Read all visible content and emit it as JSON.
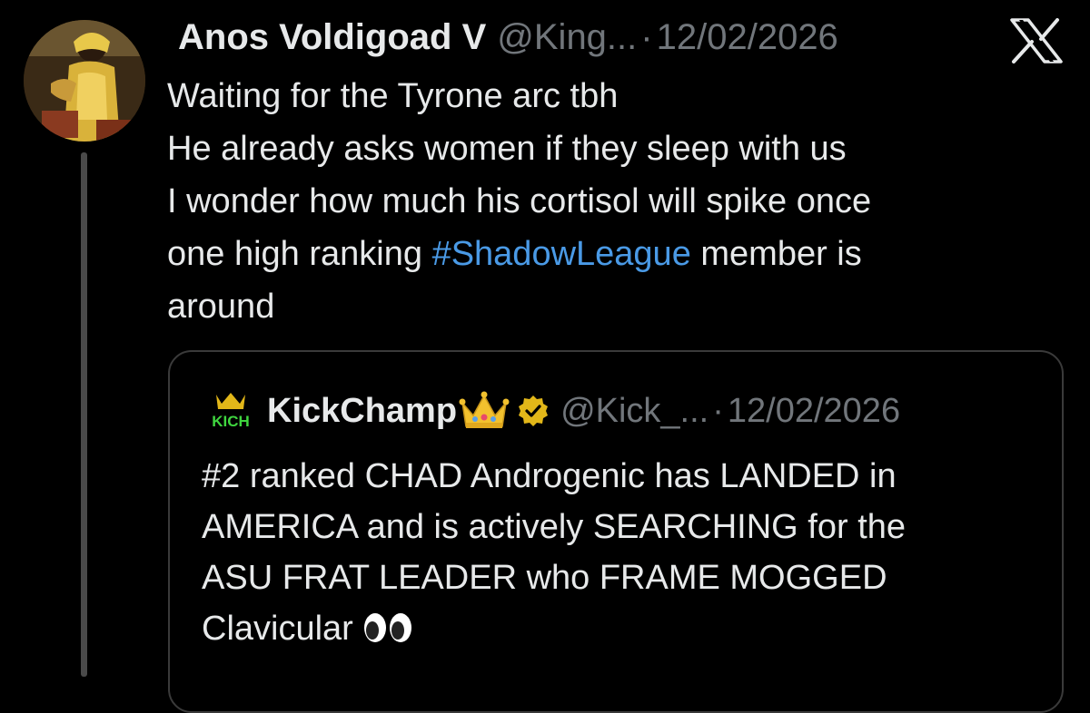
{
  "tweet": {
    "display_name": "Anos Voldigoad V",
    "handle": "@King...",
    "separator": "·",
    "date": "12/02/2026",
    "text_lines": {
      "l1": "Waiting for the Tyrone arc tbh",
      "l2": "He already asks women if they sleep with us",
      "l3": "I wonder how much his cortisol will spike once",
      "l4_before": "one high ranking ",
      "l4_hashtag": "#ShadowLeague",
      "l4_after": " member is",
      "l5": "around"
    }
  },
  "quote": {
    "avatar_text": "KICH",
    "display_name": "KickChamp",
    "handle": "@Kick_...",
    "separator": "·",
    "date": "12/02/2026",
    "text_lines": {
      "l1": "#2 ranked CHAD Androgenic has LANDED in",
      "l2": "AMERICA and is actively SEARCHING for the",
      "l3": "ASU FRAT LEADER who FRAME MOGGED",
      "l4": "Clavicular"
    }
  },
  "icons": {
    "x_logo": "x-logo-icon",
    "verified": "verified-badge-icon",
    "crown": "crown-emoji-icon",
    "eyes": "eyes-emoji-icon"
  },
  "colors": {
    "background": "#000000",
    "text": "#e7e9ea",
    "secondary": "#71767b",
    "hashtag": "#4a9ae6",
    "verified_gold": "#e2b719"
  }
}
